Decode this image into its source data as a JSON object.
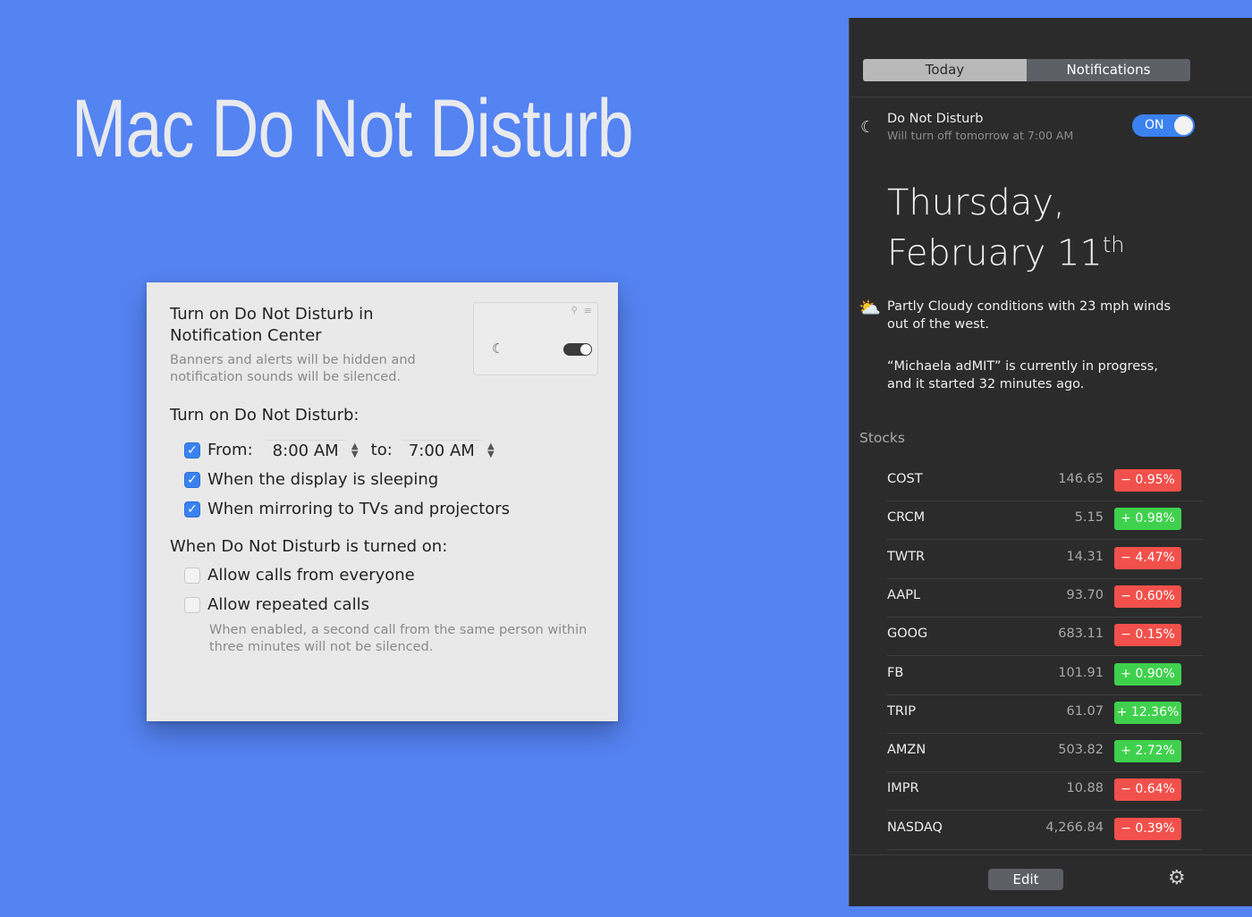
{
  "hero": {
    "title": "Mac Do Not Disturb"
  },
  "prefs": {
    "title": "Turn on Do Not Disturb in Notification Center",
    "description": "Banners and alerts will be hidden and notification sounds will be silenced.",
    "section_turn_on": "Turn on Do Not Disturb:",
    "from_label": "From:",
    "from_time": "8:00 AM",
    "to_label": "to:",
    "to_time": "7:00 AM",
    "display_sleeping": "When the display is sleeping",
    "mirroring": "When mirroring to TVs and projectors",
    "section_when_on": "When Do Not Disturb is turned on:",
    "allow_calls": "Allow calls from everyone",
    "allow_repeated": "Allow repeated calls",
    "note": "When enabled, a second call from the same person within three minutes will not be silenced.",
    "checkbox_state": {
      "from": true,
      "display_sleeping": true,
      "mirroring": true,
      "allow_calls": false,
      "allow_repeated": false
    }
  },
  "nc": {
    "tabs": {
      "today": "Today",
      "notifications": "Notifications"
    },
    "dnd": {
      "title": "Do Not Disturb",
      "subtitle": "Will turn off tomorrow at 7:00 AM",
      "toggle": "ON"
    },
    "date_line1": "Thursday,",
    "date_line2": "February 11",
    "date_suffix": "th",
    "weather": "Partly Cloudy conditions with 23 mph winds out of the west.",
    "event": "“Michaela adMIT” is currently in progress, and it started 32 minutes ago.",
    "stocks_label": "Stocks",
    "stocks": [
      {
        "symbol": "COST",
        "price": "146.65",
        "change": "− 0.95%",
        "dir": "neg"
      },
      {
        "symbol": "CRCM",
        "price": "5.15",
        "change": "+ 0.98%",
        "dir": "pos"
      },
      {
        "symbol": "TWTR",
        "price": "14.31",
        "change": "− 4.47%",
        "dir": "neg"
      },
      {
        "symbol": "AAPL",
        "price": "93.70",
        "change": "− 0.60%",
        "dir": "neg"
      },
      {
        "symbol": "GOOG",
        "price": "683.11",
        "change": "− 0.15%",
        "dir": "neg"
      },
      {
        "symbol": "FB",
        "price": "101.91",
        "change": "+ 0.90%",
        "dir": "pos"
      },
      {
        "symbol": "TRIP",
        "price": "61.07",
        "change": "+ 12.36%",
        "dir": "pos"
      },
      {
        "symbol": "AMZN",
        "price": "503.82",
        "change": "+ 2.72%",
        "dir": "pos"
      },
      {
        "symbol": "IMPR",
        "price": "10.88",
        "change": "− 0.64%",
        "dir": "neg"
      },
      {
        "symbol": "NASDAQ",
        "price": "4,266.84",
        "change": "− 0.39%",
        "dir": "neg"
      }
    ],
    "edit_label": "Edit",
    "colors": {
      "accent": "#3b82f0",
      "negative": "#f2504b",
      "positive": "#3fd14d",
      "background": "#5483f2"
    }
  }
}
